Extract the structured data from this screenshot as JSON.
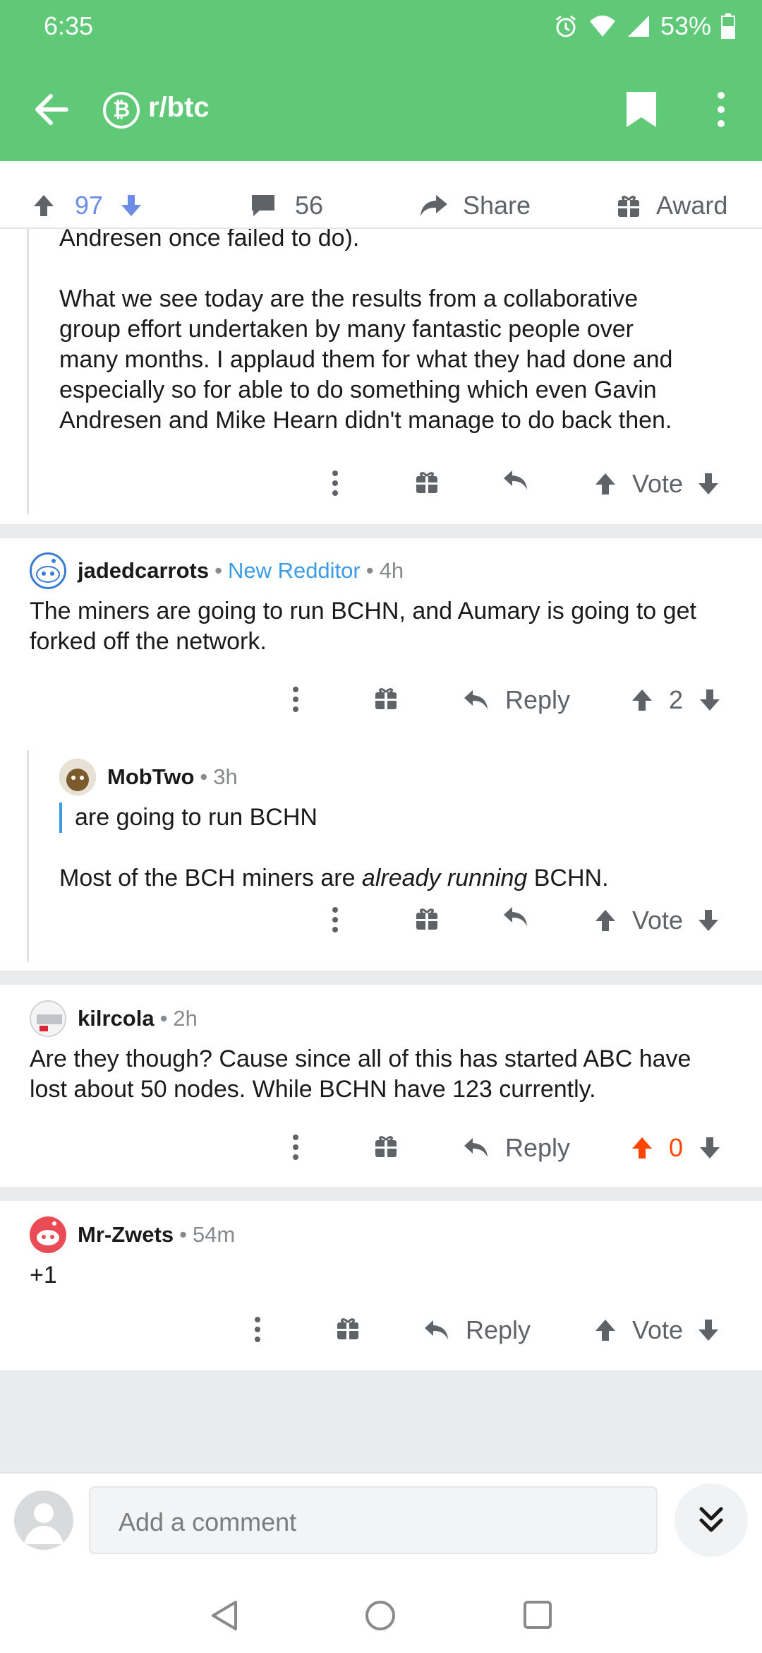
{
  "status_bar": {
    "time": "6:35",
    "battery": "53%"
  },
  "header": {
    "subreddit": "r/btc"
  },
  "post_actions": {
    "score": "97",
    "comments": "56",
    "share": "Share",
    "award": "Award"
  },
  "comments": [
    {
      "type": "continued",
      "text_lines": [
        "Andresen once failed to do).",
        "",
        "What we see today are the results from a collaborative",
        "group effort undertaken by many fantastic people over",
        "many months. I applaud them for what they had done and",
        "especially so for able to do something which even Gavin",
        "Andresen and Mike Hearn didn't manage to do back then."
      ],
      "vote_label": "Vote"
    },
    {
      "author": "jadedcarrots",
      "flair": "New Redditor",
      "time": "4h",
      "text_lines": [
        "The miners are going to run BCHN, and Aumary is going to get",
        "forked off the network."
      ],
      "reply_label": "Reply",
      "score": "2",
      "reply": {
        "author": "MobTwo",
        "time": "3h",
        "quote": "are going to run BCHN",
        "text_before": "Most of the BCH miners are ",
        "text_em": "already running",
        "text_after": " BCHN.",
        "vote_label": "Vote"
      }
    },
    {
      "author": "kilrcola",
      "time": "2h",
      "text_lines": [
        "Are they though? Cause since all of this has started ABC have",
        "lost about 50 nodes. While BCHN have 123 currently."
      ],
      "reply_label": "Reply",
      "score": "0",
      "upvoted": true
    },
    {
      "author": "Mr-Zwets",
      "time": "54m",
      "text_lines": [
        "+1"
      ],
      "reply_label": "Reply",
      "vote_label": "Vote"
    }
  ],
  "bottom_bar": {
    "placeholder": "Add a comment"
  },
  "colors": {
    "app_bar": "#5fc977",
    "upvote_active": "#ff4500",
    "score_blue": "#6b8de8",
    "flair": "#3a9be8"
  },
  "separator": "•"
}
